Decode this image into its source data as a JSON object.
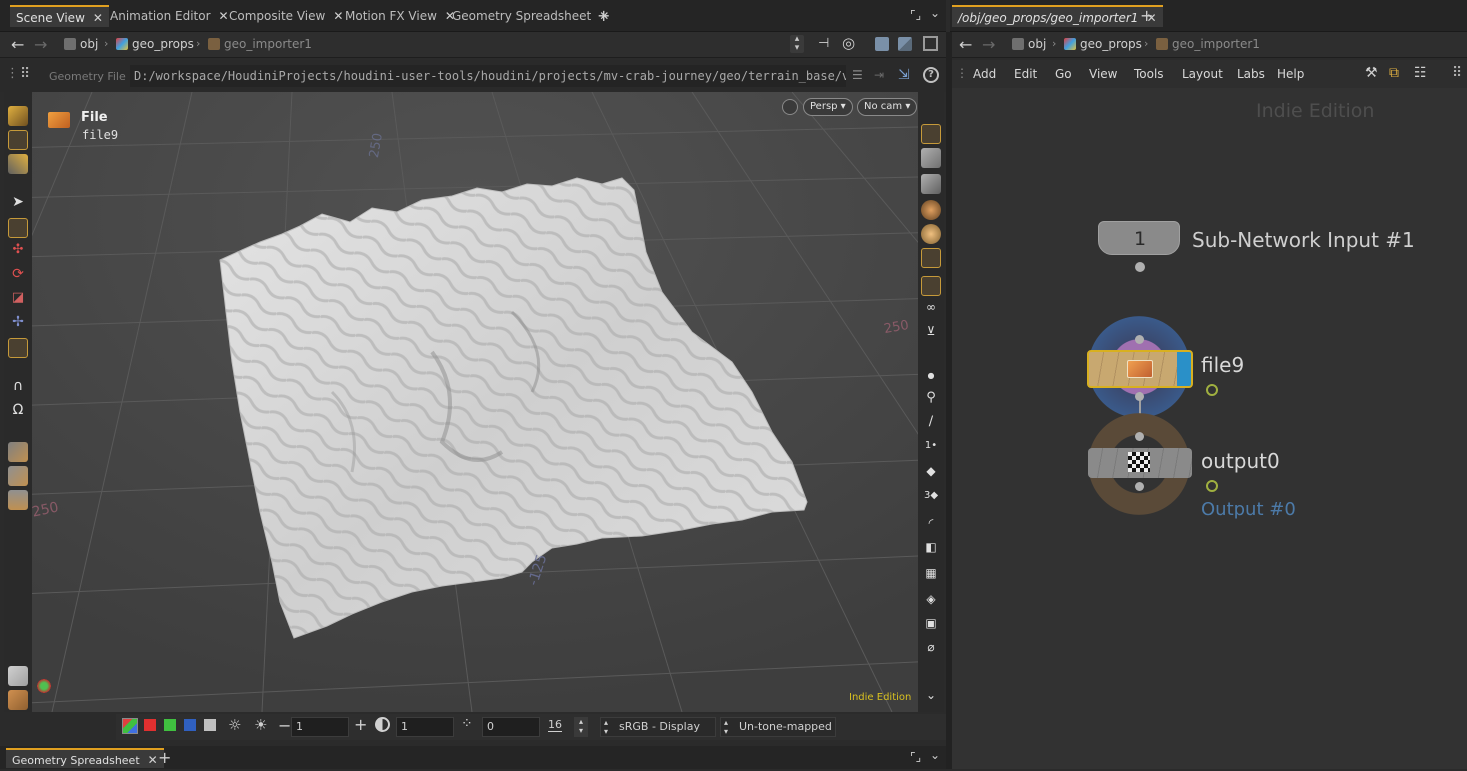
{
  "left_tabs": [
    {
      "label": "Scene View",
      "active": true
    },
    {
      "label": "Animation Editor",
      "active": false
    },
    {
      "label": "Composite View",
      "active": false
    },
    {
      "label": "Motion FX View",
      "active": false
    },
    {
      "label": "Geometry Spreadsheet",
      "active": false
    }
  ],
  "right_tab": {
    "label": "/obj/geo_props/geo_importer1"
  },
  "left_path": {
    "obj": "obj",
    "geo_props": "geo_props",
    "importer": "geo_importer1"
  },
  "right_path": {
    "obj": "obj",
    "geo_props": "geo_props",
    "importer": "geo_importer1"
  },
  "geometry_file": {
    "label": "Geometry File",
    "value": "D:/workspace/HoudiniProjects/houdini-user-tools/houdini/projects/mv-crab-journey/geo/terrain_base/v"
  },
  "viewport": {
    "node_type": "File",
    "node_name": "file9",
    "camera_mode": "Persp",
    "camera": "No cam",
    "edition": "Indie Edition",
    "axis_labels": [
      "250",
      "250",
      "-125",
      "250"
    ]
  },
  "bottom_bar": {
    "field1": "1",
    "field2": "1",
    "field3": "0",
    "colorspace": "sRGB - Display",
    "tonemap": "Un-tone-mapped"
  },
  "bottom_tab": {
    "label": "Geometry Spreadsheet"
  },
  "menus": [
    "Add",
    "Edit",
    "Go",
    "View",
    "Tools",
    "Layout",
    "Labs",
    "Help"
  ],
  "network": {
    "edition": "Indie Edition",
    "subnet_input_number": "1",
    "subnet_input_label": "Sub-Network Input #1",
    "file_node": "file9",
    "output_node": "output0",
    "output_label": "Output #0"
  },
  "colors": {
    "accent": "#e0a020",
    "file_node": "#c8a870",
    "output_blue": "#4c7aa8"
  }
}
